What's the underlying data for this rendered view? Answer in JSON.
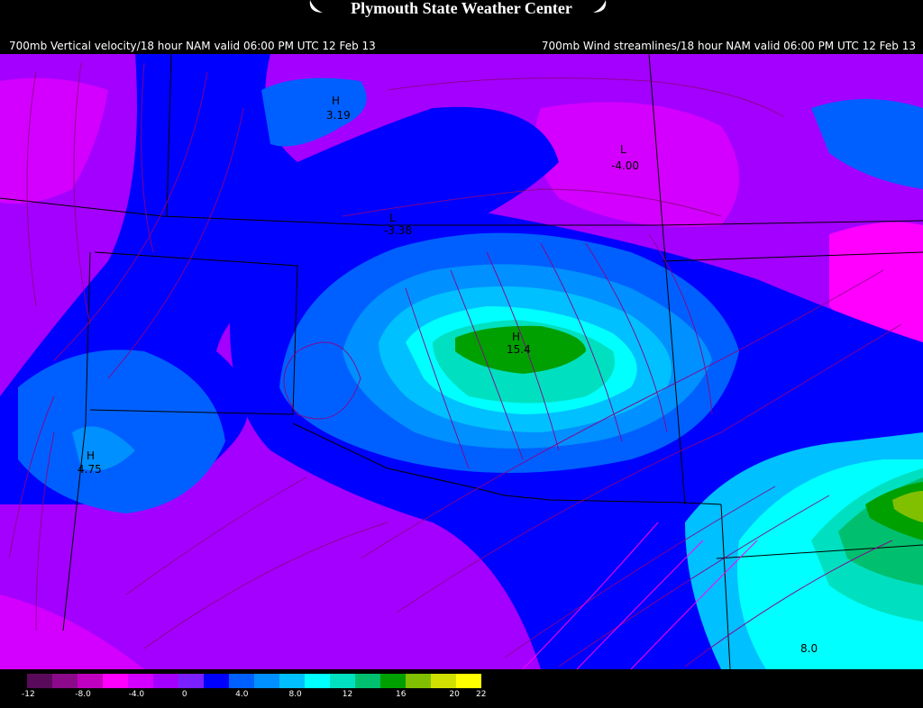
{
  "header": {
    "title": "Plymouth State Weather Center",
    "left_product": "700mb Vertical velocity/18 hour NAM valid 06:00 PM UTC 12 Feb 13",
    "right_product": "700mb Wind streamlines/18 hour NAM valid 06:00 PM UTC 12 Feb 13"
  },
  "map_labels": {
    "h1_marker": "H",
    "h1_value": "3.19",
    "h2_marker": "H",
    "h2_value": "15.4",
    "h3_marker": "H",
    "h3_value": "4.75",
    "l1_marker": "L",
    "l1_value": "-4.00",
    "l2_marker": "L",
    "l2_value": "-3.38",
    "contour_value": "8.0"
  },
  "legend": {
    "colors": [
      "#5a0a5a",
      "#8a0a8a",
      "#c000c0",
      "#ff00ff",
      "#d400ff",
      "#a400ff",
      "#7a20ff",
      "#0000ff",
      "#0060ff",
      "#0090ff",
      "#00c0ff",
      "#00ffff",
      "#00e0c0",
      "#00c070",
      "#00a000",
      "#80c000",
      "#d0e000",
      "#ffff00"
    ],
    "labels": [
      "-12",
      "-8.0",
      "-4.0",
      "0",
      "4.0",
      "8.0",
      "12",
      "16",
      "20",
      "22"
    ]
  }
}
